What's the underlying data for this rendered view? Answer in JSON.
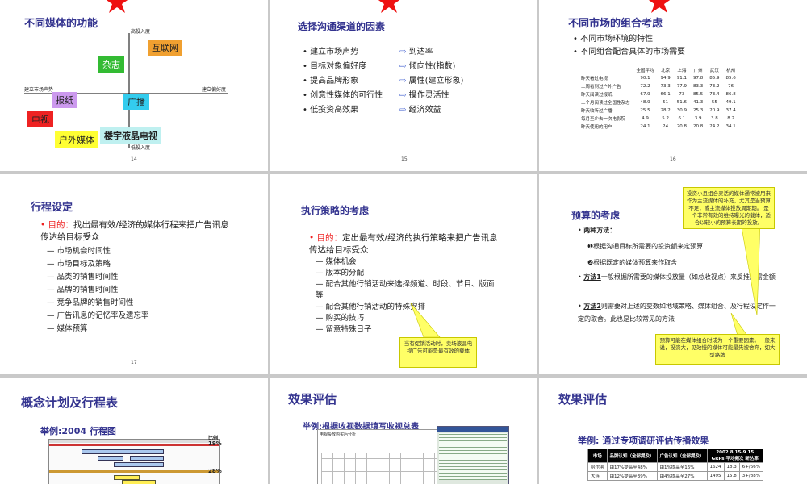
{
  "s1": {
    "title": "不同媒体的功能",
    "page": "14",
    "axis_top": "高投入度",
    "axis_bottom": "低投入度",
    "axis_left": "建立市场声势",
    "axis_right": "建立偏好度",
    "labels": {
      "internet": "互联网",
      "magazine": "杂志",
      "newspaper": "报纸",
      "radio": "广播",
      "tv": "电视",
      "lcd": "楼宇液晶电视",
      "outdoor": "户外媒体"
    },
    "colors": {
      "internet": "#f0a030",
      "magazine": "#33bb33",
      "newspaper": "#cc99ee",
      "radio": "#33ccee",
      "tv": "#ee2222",
      "lcd": "#bff0f0",
      "outdoor": "#ffff33"
    }
  },
  "s2": {
    "title": "选择沟通渠道的因素",
    "page": "15",
    "left": [
      "建立市场声势",
      "目标对象偏好度",
      "提高品牌形象",
      "创意性媒体的可行性",
      "低投资高效果"
    ],
    "right": [
      "到达率",
      "倾向性(指数)",
      "属性(建立形象)",
      "操作灵活性",
      "经济效益"
    ]
  },
  "s3": {
    "title": "不同市场的组合考虑",
    "page": "16",
    "bullets": [
      "不同市场环境的特性",
      "不同组合配合具体的市场需要"
    ],
    "headers": [
      "全国平均",
      "北京",
      "上海",
      "广州",
      "武汉",
      "杭州"
    ],
    "rows": [
      {
        "label": "昨天看过电视",
        "v": [
          "90.1",
          "94.9",
          "91.1",
          "97.8",
          "85.9",
          "85.6"
        ]
      },
      {
        "label": "上周看到过户外广告",
        "v": [
          "72.2",
          "73.3",
          "77.9",
          "83.3",
          "73.2",
          "76"
        ]
      },
      {
        "label": "昨天阅读过报纸",
        "v": [
          "67.9",
          "66.1",
          "73",
          "85.5",
          "73.4",
          "86.8"
        ]
      },
      {
        "label": "上个月阅读过全国性杂志",
        "v": [
          "48.9",
          "51",
          "51.6",
          "41.3",
          "55",
          "49.1"
        ]
      },
      {
        "label": "昨天收听过广播",
        "v": [
          "25.5",
          "28.2",
          "30.9",
          "25.3",
          "20.9",
          "37.4"
        ]
      },
      {
        "label": "每月至少去一次电影院",
        "v": [
          "4.9",
          "5.2",
          "6.1",
          "3.9",
          "3.8",
          "8.2"
        ]
      },
      {
        "label": "昨天使用的用户",
        "v": [
          "24.1",
          "24",
          "20.8",
          "20.8",
          "24.2",
          "34.1"
        ]
      }
    ]
  },
  "s4": {
    "title": "行程设定",
    "page": "17",
    "goal_prefix": "目的：",
    "goal": "找出最有效/经济的媒体行程来把广告讯息传达给目标受众",
    "items": [
      "市场机会时间性",
      "市场目标及策略",
      "品类的销售时间性",
      "品牌的销售时间性",
      "竞争品牌的销售时间性",
      "广告讯息的记忆率及遗忘率",
      "媒体预算"
    ]
  },
  "s5": {
    "title": "执行策略的考虑",
    "goal_prefix": "目的：",
    "goal": "定出最有效/经济的执行策略来把广告讯息传达给目标受众",
    "items": [
      "媒体机会",
      "版本的分配",
      "配合其他行销活动来选择频道、时段、节目、版面等",
      "配合其他行销活动的特殊安排",
      "购买的技巧",
      "留意特殊日子"
    ],
    "note": "当有促销活动时，卖场液晶电视广告可能是最有效的载体"
  },
  "s6": {
    "title": "预算的考虑",
    "bullet1": "两种方法：",
    "m1": "根据沟通目标所需要的投资额来定预算",
    "m2": "根据既定的媒体预算来作取舍",
    "method1_label": "方法1",
    "method1": "一般根据所需要的媒体投放量（如总收视点）来反推所需金额",
    "method2_label": "方法2",
    "method2": "则需要对上述的变数如地域策略、媒体组合、及行程设定作一定的取舍。此也是比较常见的方法",
    "note_top": "投资小且组合灵活的媒体通常被用来作为主流媒体的补充，尤其是当预算不足，或主流媒体投放周期期。 是一个非常有效的维持曝光的载体，适合以较小的预算长期的投放。",
    "note_bottom": "预算可能在媒体组合时成为一个重要因素。一般来说，投资大，见效慢的媒体可能最先被舍弃，如大型路牌"
  },
  "s7": {
    "title": "概念计划及行程表",
    "example": "举例:2004 行程图",
    "pct1": "19%",
    "pct2": "28%",
    "col_label": "比例"
  },
  "s8": {
    "title": "效果评估",
    "example": "举例:根据收视数据填写收视总表",
    "doc_title": "电视投放购买后分析"
  },
  "s9": {
    "title": "效果评估",
    "example": "举例: 通过专项调研评估传播效果",
    "headers": [
      "市场",
      "品牌认知（全部提及）",
      "广告认知（全部提及）",
      "GRPs",
      "平均频次",
      "新达率"
    ],
    "period": "2002.8.15-9.15",
    "rows": [
      [
        "哈尔滨",
        "由17%提高至48%",
        "由1%提高至16%",
        "1624",
        "18.3",
        "6+/66%"
      ],
      [
        "大连",
        "由12%提高至39%",
        "由4%提高至27%",
        "1495",
        "15.8",
        "3+/88%"
      ]
    ]
  },
  "colors": {
    "title": "#33338f",
    "star": "#ee1111",
    "note": "#ffff66"
  }
}
